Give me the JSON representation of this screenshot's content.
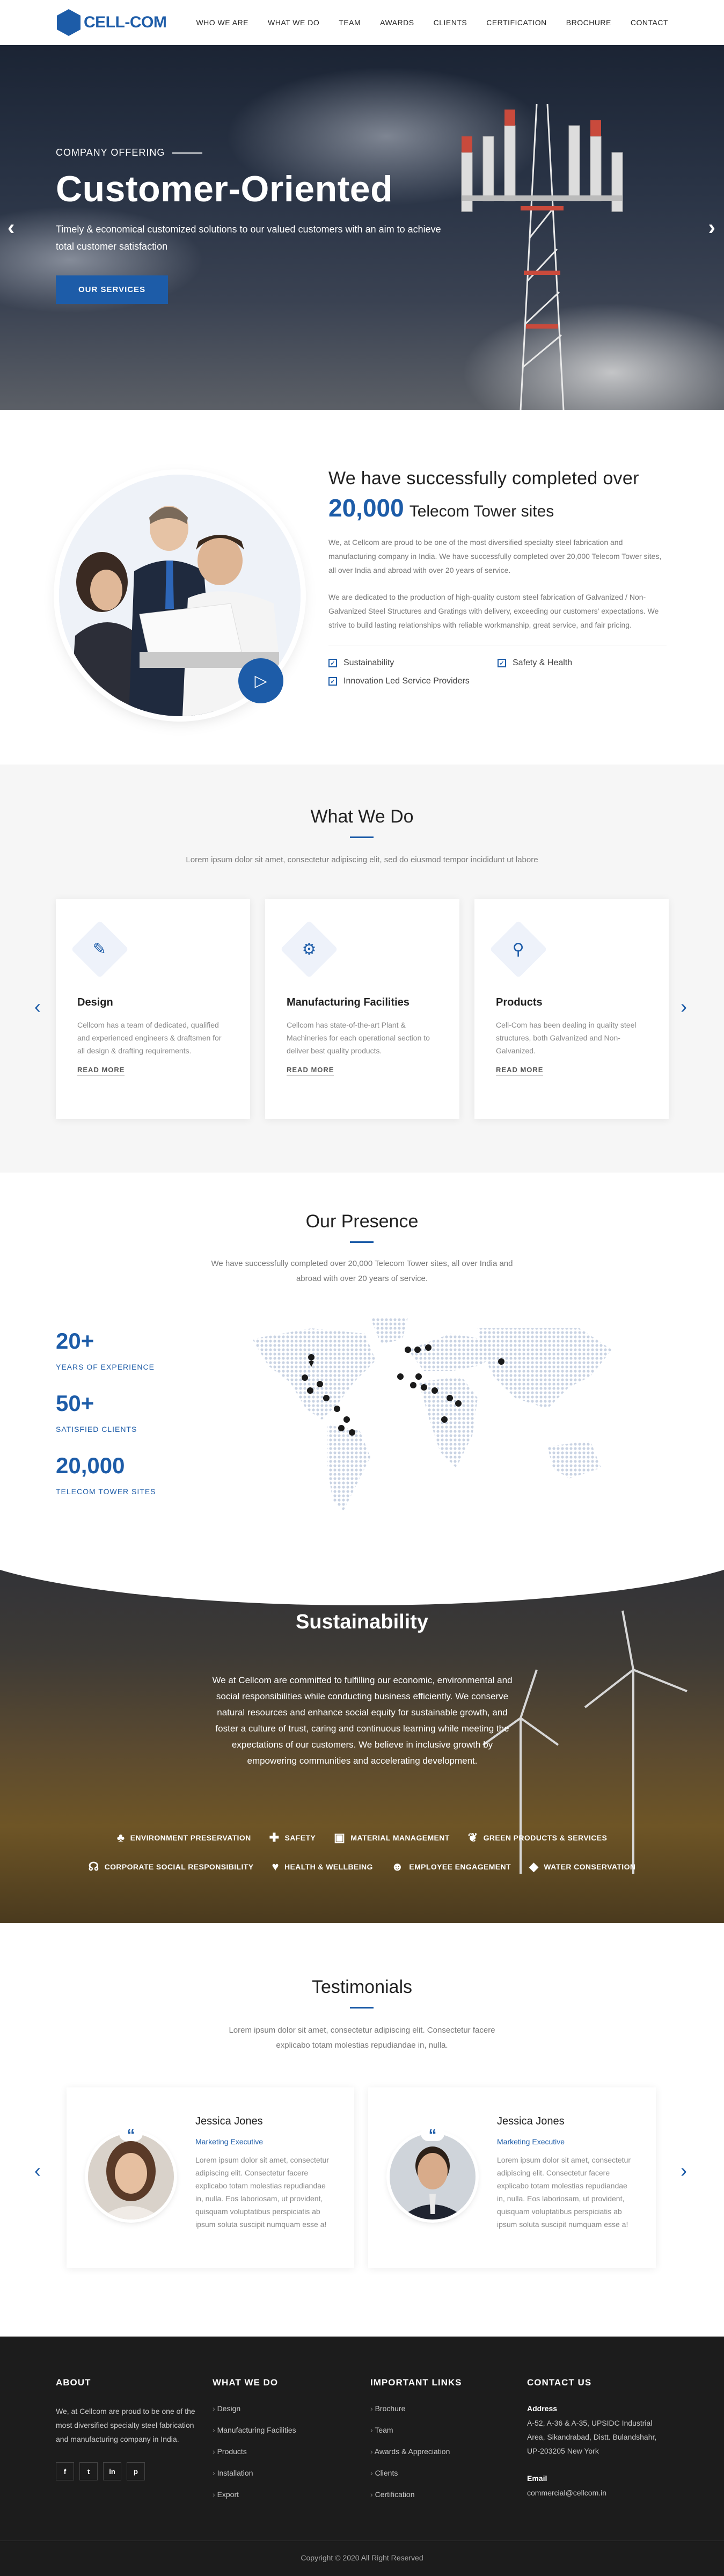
{
  "brand": {
    "name": "CELL-COM",
    "accent": "#1d5ca8"
  },
  "nav": [
    "WHO WE ARE",
    "WHAT WE DO",
    "TEAM",
    "AWARDS",
    "CLIENTS",
    "CERTIFICATION",
    "BROCHURE",
    "CONTACT"
  ],
  "hero": {
    "kicker": "COMPANY OFFERING",
    "title": "Customer-Oriented",
    "subtitle": "Timely & economical customized solutions to our valued customers with an aim to achieve total customer satisfaction",
    "button": "OUR SERVICES",
    "prev_icon": "chevron-left-icon",
    "next_icon": "chevron-right-icon"
  },
  "about": {
    "heading": "We have successfully completed over",
    "highlight": "20,000",
    "heading2": "Telecom Tower sites",
    "para1": "We, at Cellcom are proud to be one of the most diversified specialty steel fabrication and manufacturing company in India. We have successfully completed over 20,000 Telecom Tower sites, all over India and abroad with over 20 years of service.",
    "para2": "We are dedicated to the production of high-quality custom steel fabrication of Galvanized / Non-Galvanized Steel Structures and Gratings with delivery, exceeding our customers' expectations. We strive to build lasting relationships with reliable workmanship, great service, and fair pricing.",
    "checks": [
      "Sustainability",
      "Safety & Health",
      "Innovation Led Service Providers"
    ]
  },
  "what_we_do": {
    "title": "What We Do",
    "subtitle": "Lorem ipsum dolor sit amet, consectetur adipiscing elit, sed do eiusmod tempor incididunt ut labore",
    "cards": [
      {
        "icon": "edit-icon",
        "title": "Design",
        "text": "Cellcom has a team of dedicated, qualified and experienced engineers & draftsmen for all design & drafting requirements.",
        "more": "READ MORE"
      },
      {
        "icon": "gear-icon",
        "title": "Manufacturing Facilities",
        "text": "Cellcom has state-of-the-art Plant & Machineries for each operational section to deliver best quality products.",
        "more": "READ MORE"
      },
      {
        "icon": "antenna-icon",
        "title": "Products",
        "text": "Cell-Com has been dealing in quality steel structures, both Galvanized and Non-Galvanized.",
        "more": "READ MORE"
      }
    ]
  },
  "presence": {
    "title": "Our Presence",
    "subtitle_line1": "We have successfully completed over 20,000 Telecom Tower sites, all over India and",
    "subtitle_line2": "abroad with over 20 years of service.",
    "stats": [
      {
        "num": "20+",
        "label": "YEARS OF EXPERIENCE"
      },
      {
        "num": "50+",
        "label": "SATISFIED CLIENTS"
      },
      {
        "num": "20,000",
        "label": "TELECOM TOWER SITES"
      }
    ]
  },
  "sustainability": {
    "title": "Sustainability",
    "text": "We at Cellcom are committed to fulfilling our economic, environmental and social responsibilities while conducting business efficiently. We conserve natural resources and enhance social equity for sustainable growth, and foster a culture of trust, caring and continuous learning while meeting the expectations of our customers. We believe in inclusive growth by empowering communities and accelerating development.",
    "row1": [
      {
        "icon": "tree-icon",
        "label": "ENVIRONMENT PRESERVATION"
      },
      {
        "icon": "medkit-icon",
        "label": "SAFETY"
      },
      {
        "icon": "box-icon",
        "label": "MATERIAL MANAGEMENT"
      },
      {
        "icon": "leaf-icon",
        "label": "GREEN PRODUCTS & SERVICES"
      }
    ],
    "row2": [
      {
        "icon": "handshake-icon",
        "label": "CORPORATE SOCIAL RESPONSIBILITY"
      },
      {
        "icon": "heart-icon",
        "label": "HEALTH & WELLBEING"
      },
      {
        "icon": "people-icon",
        "label": "EMPLOYEE ENGAGEMENT"
      },
      {
        "icon": "drop-icon",
        "label": "WATER CONSERVATION"
      }
    ]
  },
  "testimonials": {
    "title": "Testimonials",
    "subtitle_line1": "Lorem ipsum dolor sit amet, consectetur adipiscing elit. Consectetur facere",
    "subtitle_line2": "explicabo totam molestias repudiandae in, nulla.",
    "items": [
      {
        "name": "Jessica Jones",
        "role": "Marketing Executive",
        "text": "Lorem ipsum dolor sit amet, consectetur adipiscing elit. Consectetur facere explicabo totam molestias repudiandae in, nulla. Eos laboriosam, ut provident, quisquam voluptatibus perspiciatis ab ipsum soluta suscipit numquam esse a!"
      },
      {
        "name": "Jessica Jones",
        "role": "Marketing Executive",
        "text": "Lorem ipsum dolor sit amet, consectetur adipiscing elit. Consectetur facere explicabo totam molestias repudiandae in, nulla. Eos laboriosam, ut provident, quisquam voluptatibus perspiciatis ab ipsum soluta suscipit numquam esse a!"
      }
    ]
  },
  "footer": {
    "about_title": "ABOUT",
    "about_text": "We, at Cellcom are proud to be one of the most diversified specialty steel fabrication and manufacturing company in India.",
    "social": [
      "f",
      "t",
      "in",
      "p"
    ],
    "wwd_title": "WHAT WE DO",
    "wwd_links": [
      "Design",
      "Manufacturing Facilities",
      "Products",
      "Installation",
      "Export"
    ],
    "links_title": "IMPORTANT LINKS",
    "links": [
      "Brochure",
      "Team",
      "Awards & Appreciation",
      "Clients",
      "Certification"
    ],
    "contact_title": "CONTACT US",
    "address_label": "Address",
    "address": "A-52, A-36 & A-35, UPSIDC Industrial Area, Sikandrabad, Distt. Bulandshahr, UP-203205 New York",
    "email_label": "Email",
    "email": "commercial@cellcom.in",
    "copyright": "Copyright © 2020 All Right Reserved"
  }
}
